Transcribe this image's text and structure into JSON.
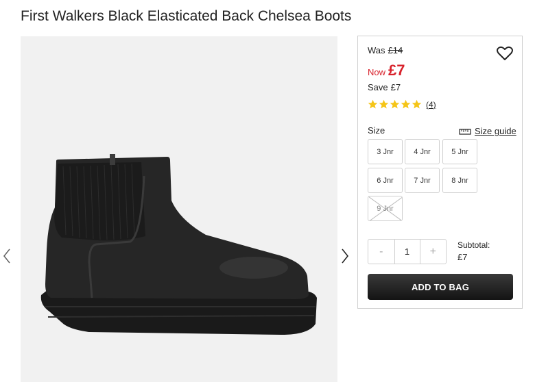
{
  "product": {
    "title": "First Walkers Black Elasticated Back Chelsea Boots",
    "image_icon": "black-chelsea-boot-photo"
  },
  "pricing": {
    "was_label": "Was",
    "was_price": "£14",
    "now_label": "Now",
    "now_price": "£7",
    "save_label": "Save",
    "save_amount": "£7"
  },
  "rating": {
    "stars": 5,
    "review_count": "(4)",
    "star_color": "#f5c518"
  },
  "size": {
    "label": "Size",
    "guide_label": "Size guide",
    "options": [
      {
        "label": "3 Jnr",
        "available": true
      },
      {
        "label": "4 Jnr",
        "available": true
      },
      {
        "label": "5 Jnr",
        "available": true
      },
      {
        "label": "6 Jnr",
        "available": true
      },
      {
        "label": "7 Jnr",
        "available": true
      },
      {
        "label": "8 Jnr",
        "available": true
      },
      {
        "label": "9 Jnr",
        "available": false
      }
    ]
  },
  "quantity": {
    "minus": "-",
    "value": "1",
    "plus": "+"
  },
  "subtotal": {
    "label": "Subtotal:",
    "value": "£7"
  },
  "actions": {
    "add_to_bag": "ADD TO BAG"
  },
  "colors": {
    "sale_red": "#d8212b",
    "button_dark": "#1e1e1e"
  }
}
